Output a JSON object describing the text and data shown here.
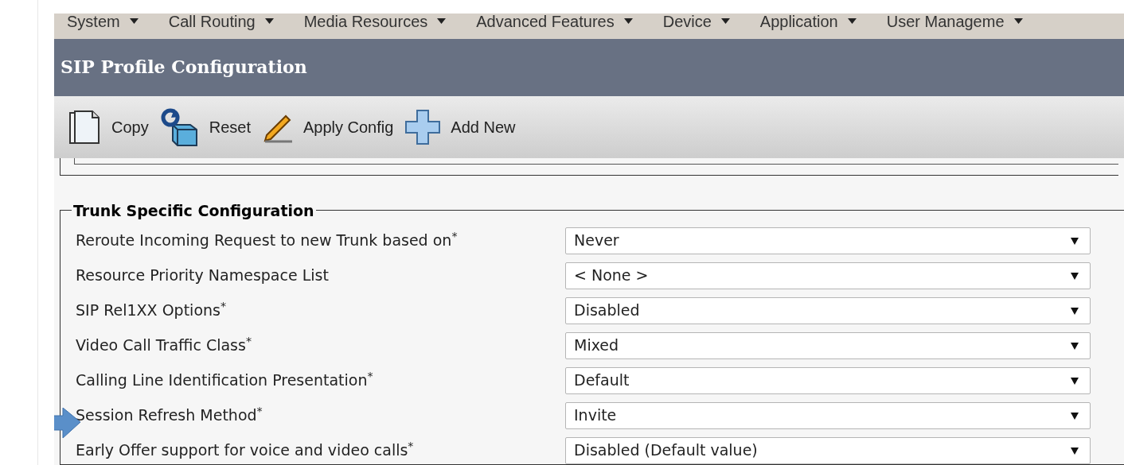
{
  "menu": [
    {
      "label": "System"
    },
    {
      "label": "Call Routing"
    },
    {
      "label": "Media Resources"
    },
    {
      "label": "Advanced Features"
    },
    {
      "label": "Device"
    },
    {
      "label": "Application"
    },
    {
      "label": "User Manageme"
    }
  ],
  "title": "SIP Profile Configuration",
  "toolbar": [
    {
      "kind": "copy",
      "label": "Copy"
    },
    {
      "kind": "reset",
      "label": "Reset"
    },
    {
      "kind": "apply",
      "label": "Apply Config"
    },
    {
      "kind": "add",
      "label": "Add New"
    }
  ],
  "section": {
    "title": "Trunk Specific Configuration",
    "rows": [
      {
        "label": "Reroute Incoming Request to new Trunk based on$^{*}$",
        "value": "Never",
        "pointed": false
      },
      {
        "label": "Resource Priority Namespace List",
        "value": "< None >",
        "pointed": false
      },
      {
        "label": "SIP Rel1XX Options$^{*}$",
        "value": "Disabled",
        "pointed": false
      },
      {
        "label": "Video Call Traffic Class$^{*}$",
        "value": "Mixed",
        "pointed": false
      },
      {
        "label": "Calling Line Identification Presentation$^{*}$",
        "value": "Default",
        "pointed": false
      },
      {
        "label": "Session Refresh Method$^{*}$",
        "value": "Invite",
        "pointed": true
      },
      {
        "label": "Early Offer support for voice and video calls$^{*}$",
        "value": "Disabled (Default value)",
        "pointed": false
      }
    ]
  }
}
